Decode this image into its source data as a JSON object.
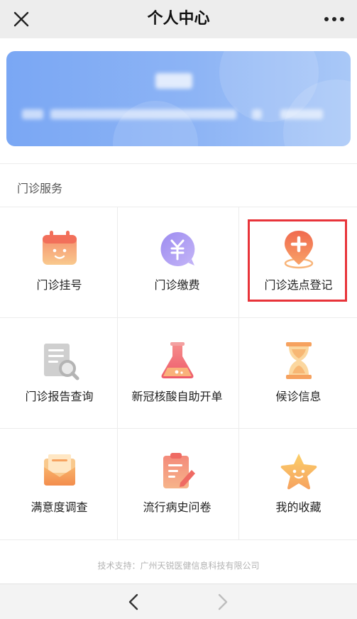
{
  "header": {
    "title": "个人中心"
  },
  "user_card": {
    "name_masked": "",
    "info_masked": ""
  },
  "section": {
    "title": "门诊服务"
  },
  "services": [
    {
      "label": "门诊挂号",
      "icon": "calendar-icon"
    },
    {
      "label": "门诊缴费",
      "icon": "payment-icon"
    },
    {
      "label": "门诊选点登记",
      "icon": "location-add-icon"
    },
    {
      "label": "门诊报告查询",
      "icon": "report-search-icon"
    },
    {
      "label": "新冠核酸自助开单",
      "icon": "flask-icon"
    },
    {
      "label": "候诊信息",
      "icon": "hourglass-icon"
    },
    {
      "label": "满意度调查",
      "icon": "envelope-icon"
    },
    {
      "label": "流行病史问卷",
      "icon": "clipboard-icon"
    },
    {
      "label": "我的收藏",
      "icon": "star-icon"
    }
  ],
  "footer": {
    "support_text": "技术支持：广州天锐医健信息科技有限公司"
  },
  "colors": {
    "card_blue": "#7aa7f4",
    "highlight_red": "#e8343a",
    "icon_orange": "#f5a35a"
  }
}
